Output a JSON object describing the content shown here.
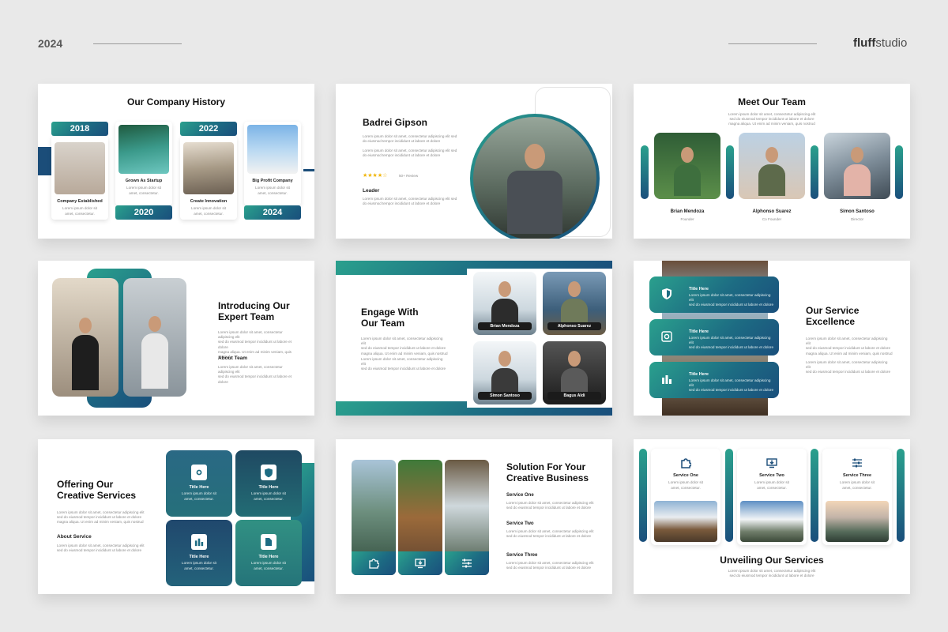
{
  "header": {
    "year": "2024",
    "brand_bold": "fluff",
    "brand_rest": "studio"
  },
  "lorem": {
    "l1": "Lorem ipsum dolor sit amet, consectetur adipiscing elit",
    "l2": "sed do eiusmod tempor incididunt ut labore et dolore",
    "l3": "magna aliqua. Ut enim ad minim veniam, quis nostrud",
    "short1": "Lorem ipsum dolor sit",
    "short2": "amet, consectetur."
  },
  "slide1": {
    "title": "Our Company History",
    "years": [
      "2018",
      "2020",
      "2022",
      "2024"
    ],
    "milestones": [
      "Company Established",
      "Grown As Startup",
      "Create Innovation",
      "Big Profit Company"
    ]
  },
  "slide2": {
    "name": "Badrei Gipson",
    "stars": "★★★★☆",
    "review": "50+ Review",
    "role": "Leader"
  },
  "slide3": {
    "title": "Meet Our Team",
    "members": [
      {
        "name": "Brian Mendoza",
        "role": "Founder"
      },
      {
        "name": "Alphonso Suarez",
        "role": "Co Founder"
      },
      {
        "name": "Simon Santoso",
        "role": "Director"
      }
    ]
  },
  "slide4": {
    "title_l1": "Introducing Our",
    "title_l2": "Expert Team",
    "subtitle": "About Team"
  },
  "slide5": {
    "title_l1": "Engage With",
    "title_l2": "Our Team",
    "members": [
      "Brian Mendoza",
      "Alphonso Suarez",
      "Simon Santoso",
      "Bagus Aldi"
    ]
  },
  "slide6": {
    "title_l1": "Our Service",
    "title_l2": "Excellence",
    "item_title": "Title Here"
  },
  "slide7": {
    "title_l1": "Offering Our",
    "title_l2": "Creative Services",
    "subtitle": "About Service",
    "tile_title": "Title Here"
  },
  "slide8": {
    "title_l1": "Solution For Your",
    "title_l2": "Creative Business",
    "services": [
      "Service One",
      "Service Two",
      "Service Three"
    ]
  },
  "slide9": {
    "title": "Unveiling Our Services",
    "services": [
      "Service One",
      "Service Two",
      "Service Three"
    ]
  },
  "colors": {
    "accent": "#2aa08d",
    "navy": "#1b4d79",
    "background": "#e9e9e9"
  },
  "icons": [
    "shield-icon",
    "gear-icon",
    "chart-icon",
    "puzzle-icon",
    "monitor-download-icon",
    "sliders-icon",
    "document-icon"
  ]
}
